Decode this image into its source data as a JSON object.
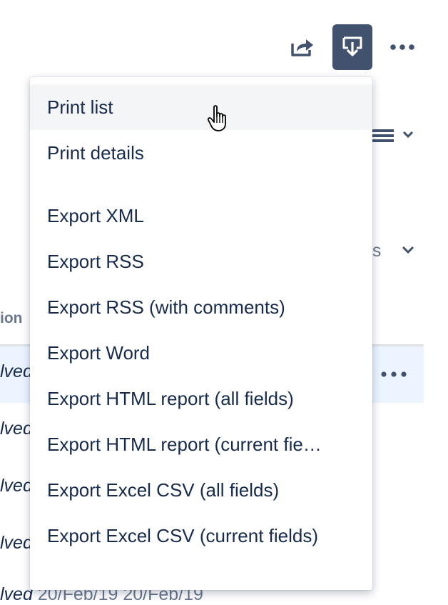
{
  "toolbar": {
    "share_icon": "share-icon",
    "export_icon": "export-download-icon",
    "more_icon": "more-dots-icon",
    "export_bg": "#42526e"
  },
  "background": {
    "view_icon": "list-view-icon",
    "columns_label": "ns",
    "header_label": "ion",
    "rows": [
      "lved",
      "lved",
      "lved",
      "lved"
    ],
    "last_row_status": "lved",
    "last_row_dates": "20/Feb/19   20/Feb/19"
  },
  "menu": {
    "group1": [
      {
        "label": "Print list"
      },
      {
        "label": "Print details"
      }
    ],
    "group2": [
      {
        "label": "Export XML"
      },
      {
        "label": "Export RSS"
      },
      {
        "label": "Export RSS (with comments)"
      },
      {
        "label": "Export Word"
      },
      {
        "label": "Export HTML report (all fields)"
      },
      {
        "label": "Export HTML report (current fie…"
      },
      {
        "label": "Export Excel CSV (all fields)"
      },
      {
        "label": "Export Excel CSV (current fields)"
      }
    ],
    "hover_bg": "#f4f5f7"
  }
}
